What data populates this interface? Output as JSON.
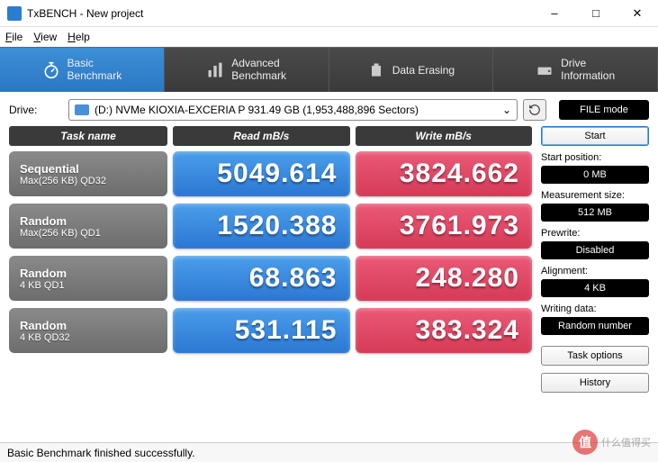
{
  "window": {
    "title": "TxBENCH - New project",
    "minimize": "–",
    "maximize": "□",
    "close": "✕"
  },
  "menu": {
    "file": "File",
    "view": "View",
    "help": "Help"
  },
  "tabs": {
    "basic": "Basic\nBenchmark",
    "advanced": "Advanced\nBenchmark",
    "erase": "Data Erasing",
    "drive": "Drive\nInformation"
  },
  "drive": {
    "label": "Drive:",
    "value": "(D:) NVMe KIOXIA-EXCERIA P  931.49 GB (1,953,488,896 Sectors)"
  },
  "filemode": "FILE mode",
  "headers": {
    "task": "Task name",
    "read": "Read mB/s",
    "write": "Write mB/s"
  },
  "rows": [
    {
      "t1": "Sequential",
      "t2": "Max(256 KB) QD32",
      "read": "5049.614",
      "write": "3824.662"
    },
    {
      "t1": "Random",
      "t2": "Max(256 KB) QD1",
      "read": "1520.388",
      "write": "3761.973"
    },
    {
      "t1": "Random",
      "t2": "4 KB QD1",
      "read": "68.863",
      "write": "248.280"
    },
    {
      "t1": "Random",
      "t2": "4 KB QD32",
      "read": "531.115",
      "write": "383.324"
    }
  ],
  "sidebar": {
    "start": "Start",
    "start_pos_label": "Start position:",
    "start_pos": "0 MB",
    "meas_label": "Measurement size:",
    "meas": "512 MB",
    "prewrite_label": "Prewrite:",
    "prewrite": "Disabled",
    "align_label": "Alignment:",
    "align": "4 KB",
    "wdata_label": "Writing data:",
    "wdata": "Random number",
    "task_options": "Task options",
    "history": "History"
  },
  "status": "Basic Benchmark finished successfully.",
  "watermark": {
    "symbol": "值",
    "text": "什么值得买"
  },
  "chart_data": {
    "type": "table",
    "title": "TxBENCH Basic Benchmark",
    "columns": [
      "Task name",
      "Read mB/s",
      "Write mB/s"
    ],
    "rows": [
      [
        "Sequential Max(256 KB) QD32",
        5049.614,
        3824.662
      ],
      [
        "Random Max(256 KB) QD1",
        1520.388,
        3761.973
      ],
      [
        "Random 4 KB QD1",
        68.863,
        248.28
      ],
      [
        "Random 4 KB QD32",
        531.115,
        383.324
      ]
    ]
  }
}
